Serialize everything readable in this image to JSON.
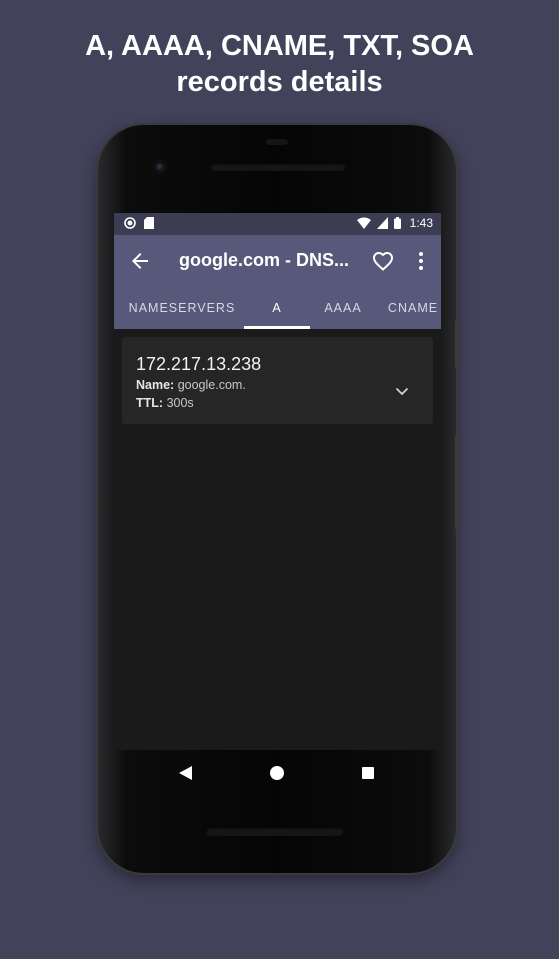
{
  "promo": {
    "line1": "A, AAAA, CNAME, TXT, SOA",
    "line2": "records details"
  },
  "statusbar": {
    "time": "1:43",
    "icons": [
      "record-icon",
      "sd-card-icon",
      "wifi-icon",
      "signal-icon",
      "battery-icon"
    ]
  },
  "appbar": {
    "title": "google.com - DNS...",
    "icons": [
      "back-arrow-icon",
      "heart-outline-icon",
      "more-vert-icon"
    ]
  },
  "tabs": [
    {
      "label": "NAMESERVERS",
      "active": false
    },
    {
      "label": "A",
      "active": true
    },
    {
      "label": "AAAA",
      "active": false
    },
    {
      "label": "CNAME",
      "active": false
    }
  ],
  "record": {
    "ip": "172.217.13.238",
    "name_label": "Name:",
    "name_value": "google.com.",
    "ttl_label": "TTL:",
    "ttl_value": "300s"
  },
  "navbar": {
    "icons": [
      "nav-back-icon",
      "nav-home-icon",
      "nav-recents-icon"
    ]
  },
  "colors": {
    "background": "#42425a",
    "appbar": "#58587a",
    "statusbar": "#3c3c52",
    "screen": "#1a1a1b",
    "card": "#262627"
  }
}
